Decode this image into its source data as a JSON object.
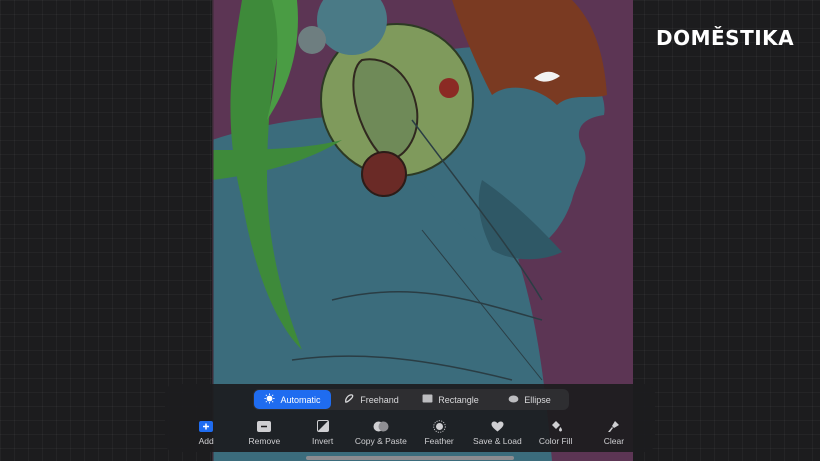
{
  "brand": {
    "logo_text": "DOMĚSTIKA"
  },
  "selection_modes": [
    {
      "label": "Automatic",
      "icon": "automatic-icon",
      "active": true
    },
    {
      "label": "Freehand",
      "icon": "freehand-icon",
      "active": false
    },
    {
      "label": "Rectangle",
      "icon": "rectangle-icon",
      "active": false
    },
    {
      "label": "Ellipse",
      "icon": "ellipse-icon",
      "active": false
    }
  ],
  "tools": [
    {
      "label": "Add",
      "icon": "add-icon"
    },
    {
      "label": "Remove",
      "icon": "remove-icon"
    },
    {
      "label": "Invert",
      "icon": "invert-icon"
    },
    {
      "label": "Copy & Paste",
      "icon": "copy-paste-icon"
    },
    {
      "label": "Feather",
      "icon": "feather-icon"
    },
    {
      "label": "Save & Load",
      "icon": "heart-icon"
    },
    {
      "label": "Color Fill",
      "icon": "color-fill-icon"
    },
    {
      "label": "Clear",
      "icon": "clear-icon"
    }
  ],
  "colors": {
    "accent": "#1f6cf0",
    "canvas_background": "#5c3554",
    "skin": "#3b6c7c",
    "hair": "#7a3a22",
    "headphone": "#7f9a5c",
    "vines": "#3e8a3a"
  }
}
